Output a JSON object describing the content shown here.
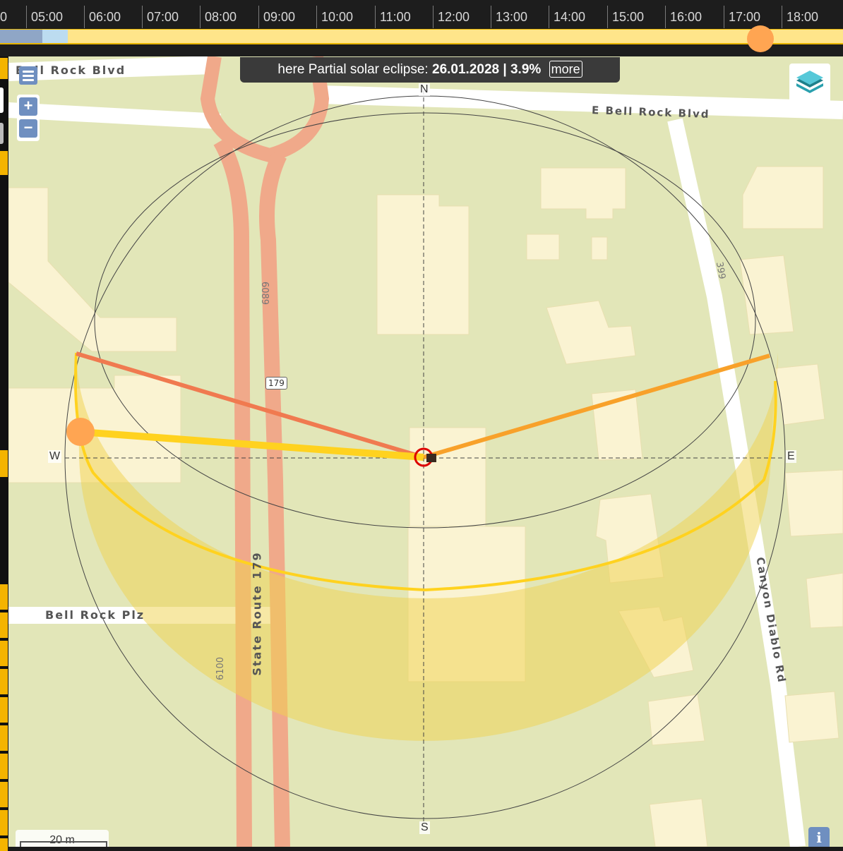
{
  "timeline": {
    "hours": [
      "0",
      "05:00",
      "06:00",
      "07:00",
      "08:00",
      "09:00",
      "10:00",
      "11:00",
      "12:00",
      "13:00",
      "14:00",
      "15:00",
      "16:00",
      "17:00",
      "18:00"
    ],
    "colors": {
      "day": "#ffe58a",
      "night": "#8fa6c6",
      "twilight": "#bcdcf0",
      "handle": "#ffa552"
    }
  },
  "banner": {
    "prefix": "here Partial solar eclipse:",
    "date": "26.01.2028",
    "separator": "|",
    "percent": "3.9%",
    "more_label": "more"
  },
  "map": {
    "road_labels": {
      "bell_rock_blvd_left": "Bell Rock Blvd",
      "e_bell_rock_blvd": "E Bell Rock Blvd",
      "bell_rock_plz": "Bell Rock Plz",
      "state_route": "State Route 179",
      "canyon_diablo": "Canyon Diablo Rd"
    },
    "numbers": {
      "n6089": "6089",
      "n6100": "6100",
      "n399": "399",
      "route_shield": "179"
    },
    "compass": {
      "n": "N",
      "s": "S",
      "e": "E",
      "w": "W"
    },
    "colors": {
      "background": "#e2e6b8",
      "road_major": "#f0a98a",
      "building": "#faf3d2",
      "sun_path": "#ffd21f",
      "sunrise_line": "#f8a12a",
      "sunset_line": "#f07a50",
      "sun": "#ffa552"
    }
  },
  "controls": {
    "zoom_in": "+",
    "zoom_out": "−",
    "menu_icon": "hamburger-icon",
    "layers_icon": "layers-icon",
    "info": "i",
    "scale": "20 m"
  }
}
